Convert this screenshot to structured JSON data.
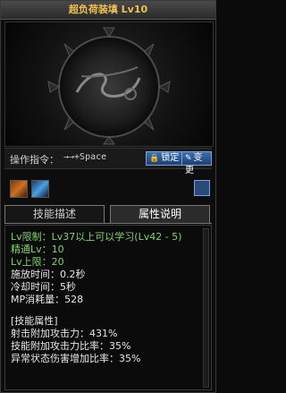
{
  "title": "超负荷装填 Lv10",
  "command": {
    "label": "操作指令：",
    "value": "→→+Space",
    "lock_button": "锁定",
    "change_button": "变更"
  },
  "tabs": {
    "description": "技能描述",
    "attributes": "属性说明"
  },
  "attributes": {
    "lv_limit": "Lv限制：Lv37以上可以学习(Lv42 - 5)",
    "mastery": "精通Lv：10",
    "lv_cap": "Lv上限：20",
    "cast_time": "施放时间：0.2秒",
    "cooldown": "冷却时间：5秒",
    "mp_cost": "MP消耗量：528",
    "section_header": "[技能属性]",
    "attack_bonus": "射击附加攻击力：431%",
    "skill_bonus": "技能附加攻击力比率：35%",
    "status_damage": "异常状态伤害增加比率：35%"
  },
  "colors": {
    "title": "#f0c050",
    "green_text": "#7fd36a",
    "button_blue": "#3d6fb0"
  }
}
